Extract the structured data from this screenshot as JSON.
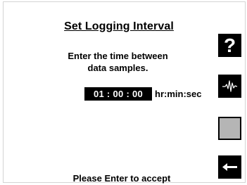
{
  "screen": {
    "title": "Set Logging Interval",
    "instruction_line1": "Enter the time between",
    "instruction_line2": "data samples.",
    "interval_value": "01 : 00 : 00",
    "interval_unit": "hr:min:sec",
    "footer": "Please Enter to accept"
  },
  "side_buttons": {
    "help_glyph": "?",
    "help_icon": "question-mark-icon",
    "waveform_icon": "waveform-icon",
    "blank_icon": "blank-key-icon",
    "back_icon": "left-arrow-icon"
  },
  "colors": {
    "background": "#ffffff",
    "button": "#000000",
    "blank_key": "#b5b5b5",
    "text": "#000000"
  }
}
